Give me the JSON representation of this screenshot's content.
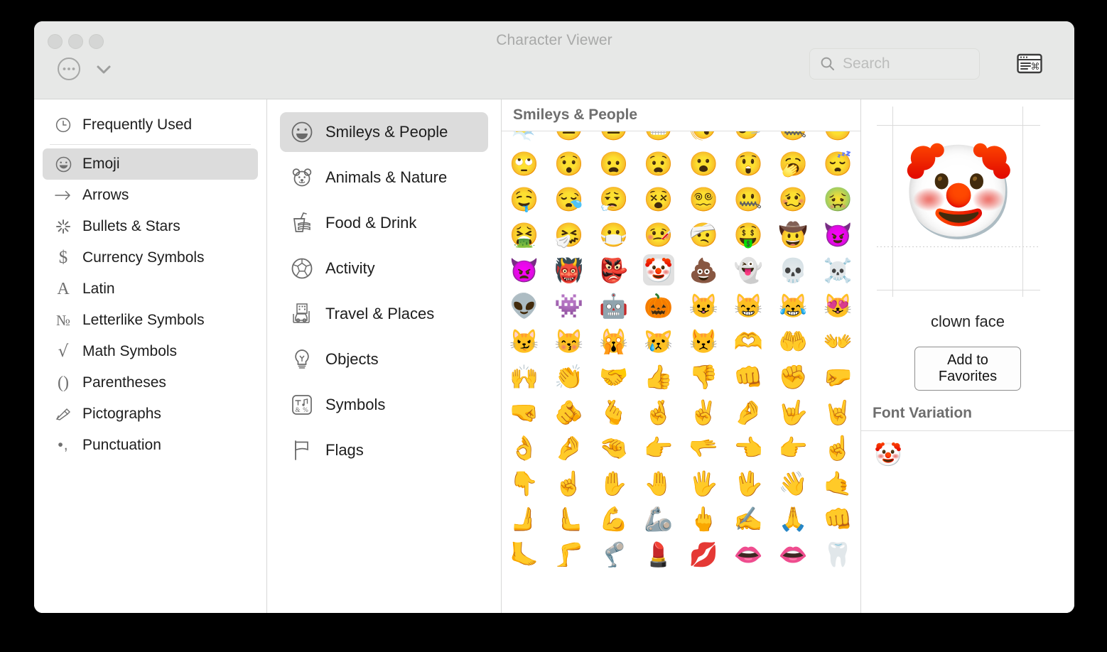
{
  "window": {
    "title": "Character Viewer",
    "traffic_lights": [
      "close-button",
      "minimize-button",
      "zoom-button"
    ]
  },
  "toolbar": {
    "more_icon": "ellipsis-circle-icon",
    "chevron_icon": "chevron-down-icon",
    "keyboard_viewer_icon": "keyboard-viewer-icon"
  },
  "search": {
    "placeholder": "Search",
    "value": "",
    "icon": "search-icon"
  },
  "sidebar": {
    "items": [
      {
        "label": "Frequently Used",
        "icon": "clock-icon",
        "selected": false
      },
      {
        "label": "Emoji",
        "icon": "smiley-icon",
        "selected": true
      },
      {
        "label": "Arrows",
        "icon": "arrow-right-icon",
        "selected": false
      },
      {
        "label": "Bullets & Stars",
        "icon": "asterisk-icon",
        "selected": false
      },
      {
        "label": "Currency Symbols",
        "icon": "dollar-icon",
        "selected": false
      },
      {
        "label": "Latin",
        "icon": "letter-a-icon",
        "selected": false
      },
      {
        "label": "Letterlike Symbols",
        "icon": "numero-icon",
        "selected": false
      },
      {
        "label": "Math Symbols",
        "icon": "square-root-icon",
        "selected": false
      },
      {
        "label": "Parentheses",
        "icon": "parentheses-icon",
        "selected": false
      },
      {
        "label": "Pictographs",
        "icon": "writing-hand-icon",
        "selected": false
      },
      {
        "label": "Punctuation",
        "icon": "dot-comma-icon",
        "selected": false
      }
    ]
  },
  "categories": {
    "items": [
      {
        "label": "Smileys & People",
        "icon": "smiley-outline-icon",
        "selected": true
      },
      {
        "label": "Animals & Nature",
        "icon": "bear-outline-icon",
        "selected": false
      },
      {
        "label": "Food & Drink",
        "icon": "burger-drink-icon",
        "selected": false
      },
      {
        "label": "Activity",
        "icon": "soccer-ball-icon",
        "selected": false
      },
      {
        "label": "Travel & Places",
        "icon": "car-building-icon",
        "selected": false
      },
      {
        "label": "Objects",
        "icon": "lightbulb-icon",
        "selected": false
      },
      {
        "label": "Symbols",
        "icon": "symbols-box-icon",
        "selected": false
      },
      {
        "label": "Flags",
        "icon": "flag-icon",
        "selected": false
      }
    ]
  },
  "grid": {
    "header": "Smileys & People",
    "columns": 8,
    "selected_char": "🤡",
    "chars": [
      "😶‍🌫️",
      "😐",
      "😑",
      "😬",
      "🫨",
      "🙂‍↔️",
      "🤐",
      "😶",
      "🙄",
      "😯",
      "😦",
      "😧",
      "😮",
      "😲",
      "🥱",
      "😴",
      "🤤",
      "😪",
      "😮‍💨",
      "😵",
      "😵‍💫",
      "🤐",
      "🥴",
      "🤢",
      "🤮",
      "🤧",
      "😷",
      "🤒",
      "🤕",
      "🤑",
      "🤠",
      "😈",
      "👿",
      "👹",
      "👺",
      "🤡",
      "💩",
      "👻",
      "💀",
      "☠️",
      "👽",
      "👾",
      "🤖",
      "🎃",
      "😺",
      "😸",
      "😹",
      "😻",
      "😼",
      "😽",
      "🙀",
      "😿",
      "😾",
      "🫶",
      "🤲",
      "👐",
      "🙌",
      "👏",
      "🤝",
      "👍",
      "👎",
      "👊",
      "✊",
      "🤛",
      "🤜",
      "🫵",
      "🫰",
      "🤞",
      "✌️",
      "🤌",
      "🤟",
      "🤘",
      "👌",
      "🤌",
      "🤏",
      "👉",
      "🫳",
      "👈",
      "👉",
      "☝️",
      "👇",
      "☝️",
      "✋",
      "🤚",
      "🖐️",
      "🖖",
      "👋",
      "🤙",
      "🫸",
      "🫷",
      "💪",
      "🦾",
      "🖕",
      "✍️",
      "🙏",
      "👊",
      "🦶",
      "🦵",
      "🦿",
      "💄",
      "💋",
      "👄",
      "👄",
      "🦷"
    ]
  },
  "preview": {
    "glyph": "🤡",
    "name": "clown face",
    "add_to_favorites_label": "Add to Favorites",
    "font_variation_title": "Font Variation",
    "font_variations": [
      "🤡"
    ]
  },
  "colors": {
    "window_chrome": "#e7e8e7",
    "selection": "#dcdcdc",
    "header_text": "#6e6e6e",
    "divider": "#d7d8d7"
  }
}
